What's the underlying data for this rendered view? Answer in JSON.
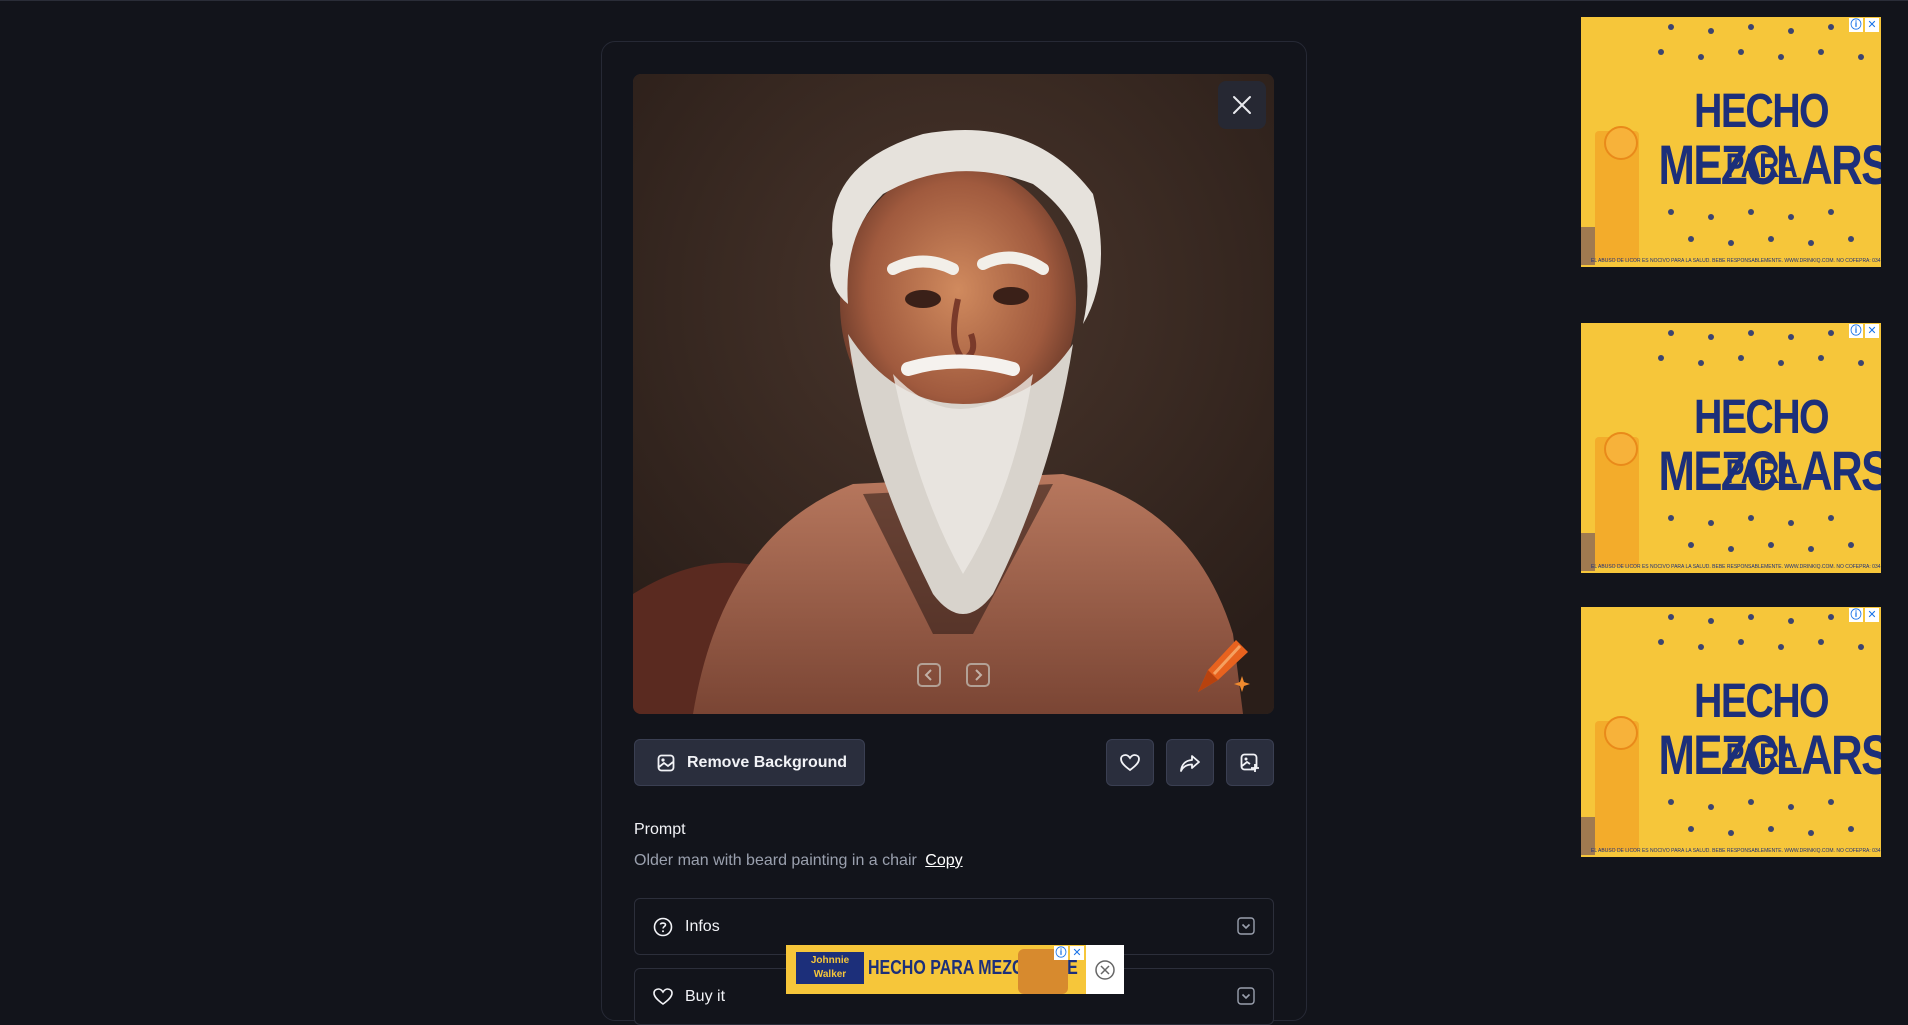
{
  "image": {
    "alt": ""
  },
  "actions": {
    "remove_background": "Remove Background"
  },
  "prompt": {
    "label": "Prompt",
    "text": "Older man with beard painting in a chair",
    "copy": "Copy"
  },
  "accordions": [
    {
      "label": "Infos"
    },
    {
      "label": "Buy it"
    }
  ],
  "ads": {
    "headline_part1": "HECHO",
    "headline_para": "PARA",
    "headline_part2": "MEZCLARSE",
    "fine_print": "EL ABUSO DE LICOR ES NOCIVO PARA LA SALUD. BEBE RESPONSABLEMENTE. WWW.DRINKIQ.COM. NO COFEPRA: 0341-2024",
    "bottom_brand": "Johnnie Walker BLONDE",
    "bottom_text": "HECHO PARA MEZCLARSE",
    "info_icon": "ⓘ",
    "close_icon": "✕"
  },
  "colors": {
    "background": "#12141b",
    "button": "#2a2e3d",
    "ad_yellow": "#f6c63a",
    "ad_blue": "#1c2f7a"
  }
}
